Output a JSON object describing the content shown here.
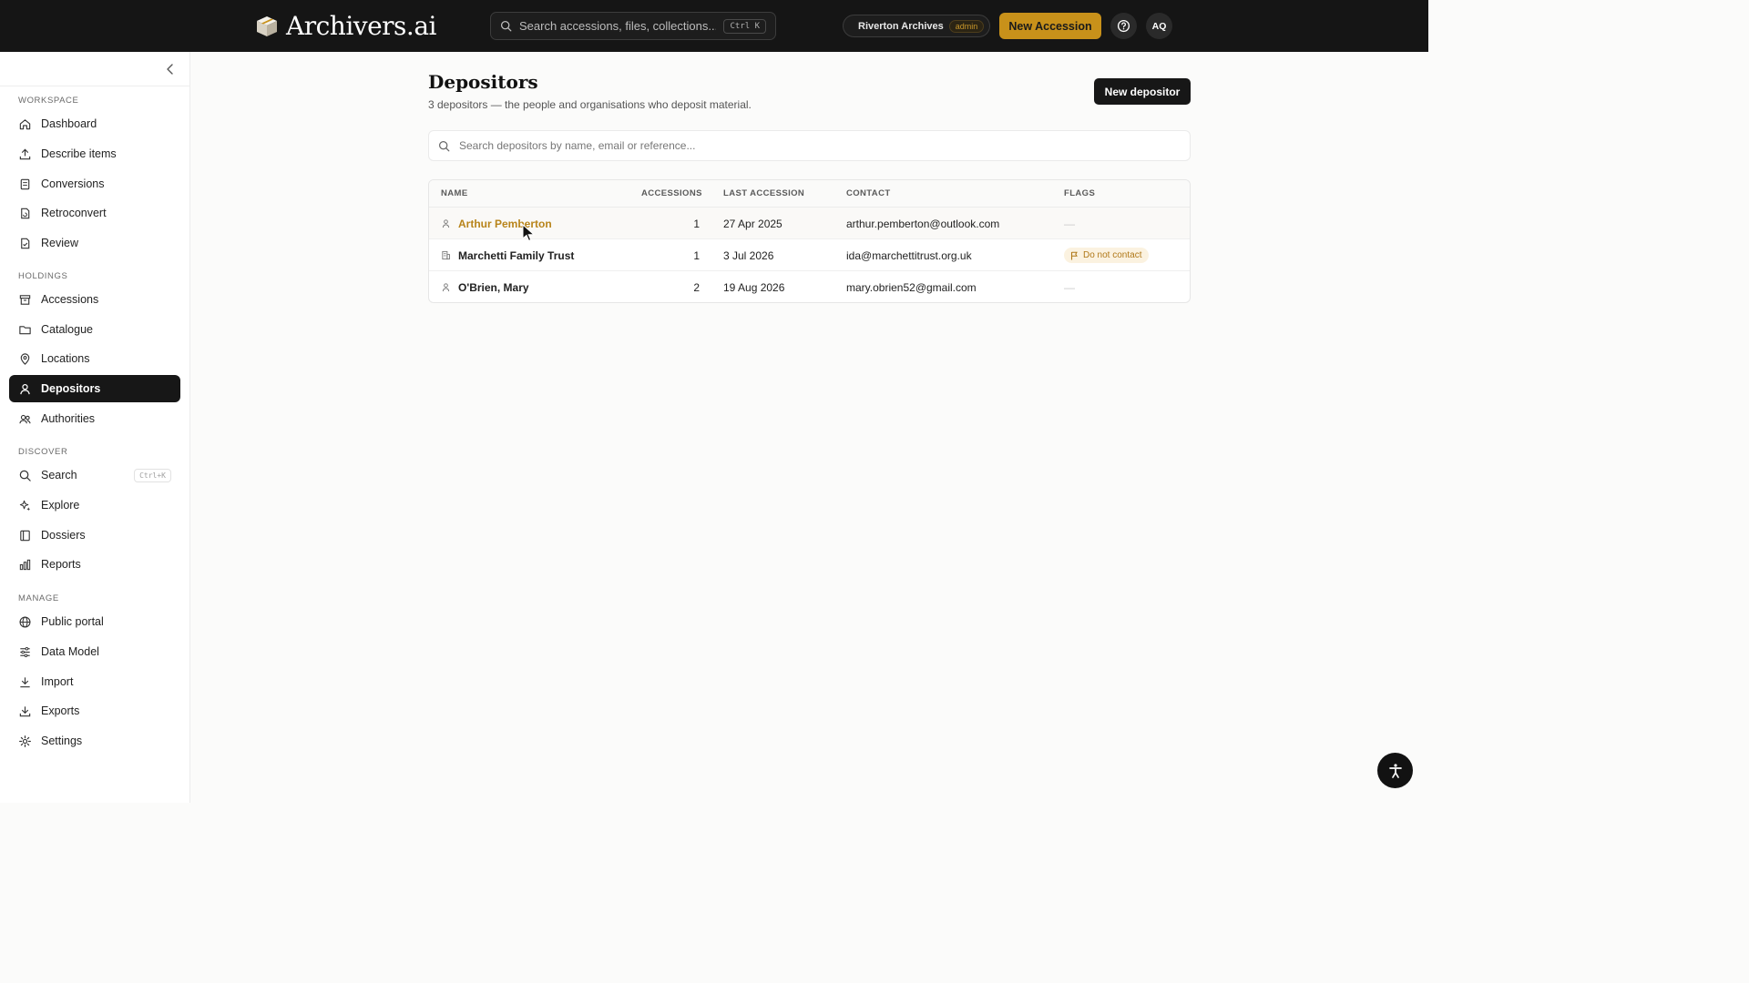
{
  "header": {
    "logo_text": "Archivers.ai",
    "search_placeholder": "Search accessions, files, collections...",
    "search_shortcut": "Ctrl K",
    "org_name": "Riverton Archives",
    "org_role": "admin",
    "new_accession_label": "New Accession",
    "avatar_initials": "AQ"
  },
  "sidebar": {
    "sections": {
      "workspace": "WORKSPACE",
      "holdings": "HOLDINGS",
      "discover": "DISCOVER",
      "manage": "MANAGE"
    },
    "items": [
      {
        "label": "Dashboard",
        "icon": "home-icon"
      },
      {
        "label": "Describe items",
        "icon": "upload-icon"
      },
      {
        "label": "Conversions",
        "icon": "convert-icon"
      },
      {
        "label": "Retroconvert",
        "icon": "file-convert-icon"
      },
      {
        "label": "Review",
        "icon": "file-check-icon"
      },
      {
        "label": "Accessions",
        "icon": "archive-box-icon"
      },
      {
        "label": "Catalogue",
        "icon": "folder-icon"
      },
      {
        "label": "Locations",
        "icon": "map-pin-icon"
      },
      {
        "label": "Depositors",
        "icon": "user-icon",
        "active": true
      },
      {
        "label": "Authorities",
        "icon": "users-icon"
      },
      {
        "label": "Search",
        "icon": "search-icon",
        "shortcut": "Ctrl+K"
      },
      {
        "label": "Explore",
        "icon": "sparkles-icon"
      },
      {
        "label": "Dossiers",
        "icon": "book-icon"
      },
      {
        "label": "Reports",
        "icon": "bar-chart-icon"
      },
      {
        "label": "Public portal",
        "icon": "globe-icon"
      },
      {
        "label": "Data Model",
        "icon": "sliders-icon"
      },
      {
        "label": "Import",
        "icon": "import-icon"
      },
      {
        "label": "Exports",
        "icon": "download-icon"
      },
      {
        "label": "Settings",
        "icon": "gear-icon"
      }
    ]
  },
  "main": {
    "title": "Depositors",
    "subtitle": "3 depositors — the people and organisations who deposit material.",
    "new_button": "New depositor",
    "search_placeholder": "Search depositors by name, email or reference...",
    "columns": [
      "NAME",
      "ACCESSIONS",
      "LAST ACCESSION",
      "CONTACT",
      "FLAGS"
    ],
    "rows": [
      {
        "name": "Arthur Pemberton",
        "type": "person",
        "accessions": "1",
        "last_accession": "27 Apr 2025",
        "contact": "arthur.pemberton@outlook.com",
        "flag": "—"
      },
      {
        "name": "Marchetti Family Trust",
        "type": "organisation",
        "accessions": "1",
        "last_accession": "3 Jul 2026",
        "contact": "ida@marchettitrust.org.uk",
        "flag": "Do not contact"
      },
      {
        "name": "O'Brien, Mary",
        "type": "person",
        "accessions": "2",
        "last_accession": "19 Aug 2026",
        "contact": "mary.obrien52@gmail.com",
        "flag": "—"
      }
    ]
  },
  "colors": {
    "accent": "#c8911a",
    "link": "#b8841a",
    "dark": "#151515"
  }
}
